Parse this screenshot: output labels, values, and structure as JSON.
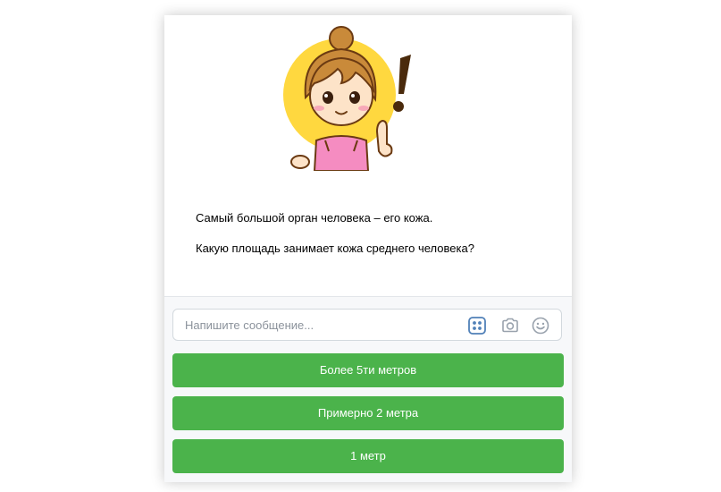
{
  "message": {
    "line1": "Самый большой орган человека – его кожа.",
    "line2": "Какую площадь занимает кожа среднего человека?"
  },
  "composer": {
    "placeholder": "Напишите сообщение..."
  },
  "icons": {
    "sticker": "girl-sticker-exclamation",
    "keyboard": "keyboard-icon",
    "camera": "camera-icon",
    "smile": "smile-icon"
  },
  "reply_buttons": [
    {
      "label": "Более 5ти метров"
    },
    {
      "label": "Примерно 2 метра"
    },
    {
      "label": "1 метр"
    }
  ],
  "colors": {
    "button_green": "#4bb34b",
    "icon_blue": "#5181b8",
    "sticker_yellow": "#ffd83f"
  }
}
